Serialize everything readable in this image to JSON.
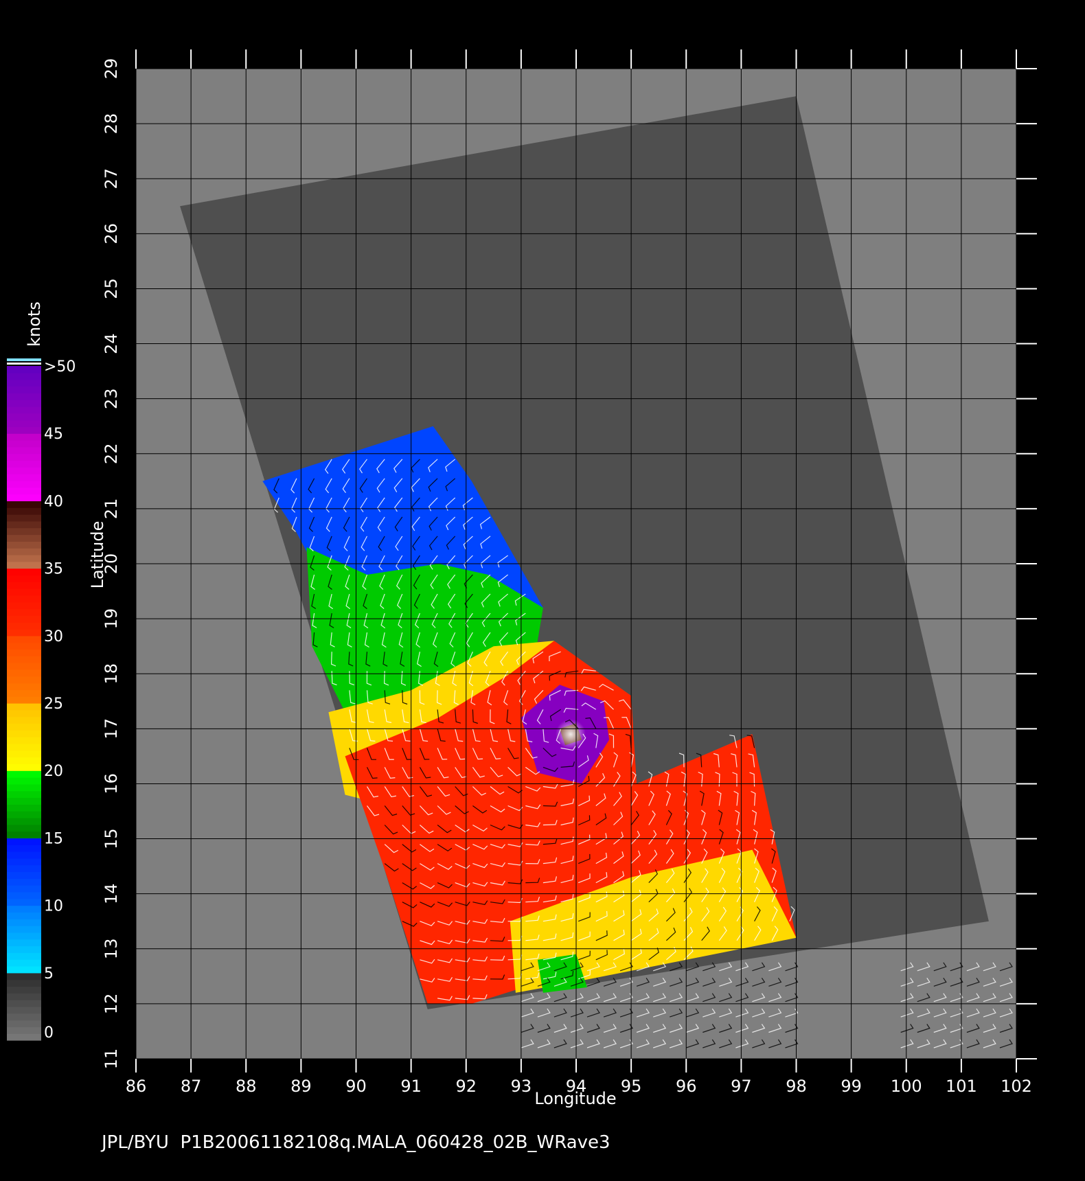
{
  "footer": {
    "source_text": "JPL/BYU  P1B20061182108q.MALA_060428_02B_WRave3"
  },
  "axes": {
    "xlabel": "Longitude",
    "ylabel": "Latitude",
    "x_ticks": [
      "86",
      "87",
      "88",
      "89",
      "90",
      "91",
      "92",
      "93",
      "94",
      "95",
      "96",
      "97",
      "98",
      "99",
      "100",
      "101",
      "102"
    ],
    "y_ticks": [
      "11",
      "12",
      "13",
      "14",
      "15",
      "16",
      "17",
      "18",
      "19",
      "20",
      "21",
      "22",
      "23",
      "24",
      "25",
      "26",
      "27",
      "28",
      "29"
    ],
    "xlim": [
      86,
      102
    ],
    "ylim": [
      11,
      29
    ]
  },
  "colorbar": {
    "unit_label": "knots",
    "tick_labels": [
      "0",
      "5",
      "10",
      "15",
      "20",
      "25",
      "30",
      "35",
      "40",
      "45",
      ">50"
    ],
    "bands": [
      {
        "min": 0,
        "max": 5,
        "colors": [
          "#7a7a7a",
          "#2a2a2a"
        ]
      },
      {
        "min": 5,
        "max": 10,
        "colors": [
          "#00e8ff",
          "#0078ff"
        ]
      },
      {
        "min": 10,
        "max": 15,
        "colors": [
          "#0068ff",
          "#0010ff"
        ]
      },
      {
        "min": 15,
        "max": 20,
        "colors": [
          "#007a00",
          "#00ff00"
        ]
      },
      {
        "min": 20,
        "max": 25,
        "colors": [
          "#ffff00",
          "#ffc000"
        ]
      },
      {
        "min": 25,
        "max": 30,
        "colors": [
          "#ff8000",
          "#ff4800"
        ]
      },
      {
        "min": 30,
        "max": 35,
        "colors": [
          "#ff3000",
          "#ff0000"
        ]
      },
      {
        "min": 35,
        "max": 40,
        "colors": [
          "#c87850",
          "#300000"
        ]
      },
      {
        "min": 40,
        "max": 45,
        "colors": [
          "#ff00ff",
          "#c000c8"
        ]
      },
      {
        "min": 45,
        "max": 50,
        "colors": [
          "#a000c0",
          "#6000c0"
        ]
      }
    ]
  },
  "colors": {
    "background": "#000000",
    "plot_area": "#7f7f7f",
    "swath_no_data": "#4f4f4f",
    "grid": "#000000"
  },
  "chart_data": {
    "type": "heatmap",
    "description_units": "wind speed in knots over lon/lat",
    "swath_corners_lonlat": [
      [
        86.8,
        26.5
      ],
      [
        98.0,
        28.5
      ],
      [
        101.5,
        13.5
      ],
      [
        91.3,
        11.9
      ]
    ],
    "wind_regions": [
      {
        "name": "north-coast-band",
        "speed": 12,
        "lonlat": [
          [
            88.3,
            21.5
          ],
          [
            91.4,
            22.5
          ],
          [
            92.1,
            21.5
          ],
          [
            93.4,
            19.2
          ],
          [
            93.0,
            18.0
          ],
          [
            91.0,
            18.3
          ],
          [
            89.8,
            18.9
          ],
          [
            88.9,
            20.6
          ]
        ]
      },
      {
        "name": "green-band",
        "speed": 18,
        "lonlat": [
          [
            89.1,
            20.3
          ],
          [
            90.2,
            19.8
          ],
          [
            91.5,
            20.0
          ],
          [
            92.4,
            19.8
          ],
          [
            93.4,
            19.2
          ],
          [
            93.2,
            18.0
          ],
          [
            92.3,
            17.4
          ],
          [
            91.0,
            17.0
          ],
          [
            90.0,
            16.9
          ],
          [
            89.2,
            18.5
          ]
        ]
      },
      {
        "name": "yellow-band",
        "speed": 23,
        "lonlat": [
          [
            89.5,
            17.3
          ],
          [
            91.0,
            17.7
          ],
          [
            92.5,
            18.5
          ],
          [
            93.6,
            18.6
          ],
          [
            93.2,
            17.5
          ],
          [
            92.4,
            16.2
          ],
          [
            91.0,
            15.5
          ],
          [
            89.8,
            15.8
          ]
        ]
      },
      {
        "name": "red-main",
        "speed": 31,
        "lonlat": [
          [
            89.8,
            16.5
          ],
          [
            91.5,
            17.2
          ],
          [
            92.8,
            18.0
          ],
          [
            93.6,
            18.6
          ],
          [
            95.0,
            17.6
          ],
          [
            95.1,
            16.0
          ],
          [
            97.2,
            16.9
          ],
          [
            98.0,
            13.2
          ],
          [
            97.0,
            13.1
          ],
          [
            94.0,
            12.6
          ],
          [
            92.1,
            12.0
          ],
          [
            91.3,
            12.0
          ],
          [
            90.5,
            14.5
          ]
        ]
      },
      {
        "name": "yellow-south",
        "speed": 23,
        "lonlat": [
          [
            92.8,
            13.5
          ],
          [
            95.0,
            14.3
          ],
          [
            97.2,
            14.8
          ],
          [
            98.0,
            13.2
          ],
          [
            94.0,
            12.4
          ],
          [
            92.9,
            12.2
          ]
        ]
      },
      {
        "name": "green-south",
        "speed": 18,
        "lonlat": [
          [
            93.3,
            12.8
          ],
          [
            94.0,
            12.9
          ],
          [
            94.2,
            12.3
          ],
          [
            93.4,
            12.2
          ]
        ]
      },
      {
        "name": "cyclone-purple",
        "speed": 47,
        "lonlat": [
          [
            93.0,
            17.2
          ],
          [
            93.7,
            17.8
          ],
          [
            94.5,
            17.5
          ],
          [
            94.6,
            16.8
          ],
          [
            94.1,
            16.0
          ],
          [
            93.3,
            16.2
          ]
        ]
      },
      {
        "name": "storm-eye",
        "speed": 38,
        "lonlat": [
          [
            93.7,
            17.0
          ],
          [
            94.0,
            17.1
          ],
          [
            94.1,
            16.8
          ],
          [
            93.8,
            16.7
          ]
        ]
      }
    ]
  }
}
